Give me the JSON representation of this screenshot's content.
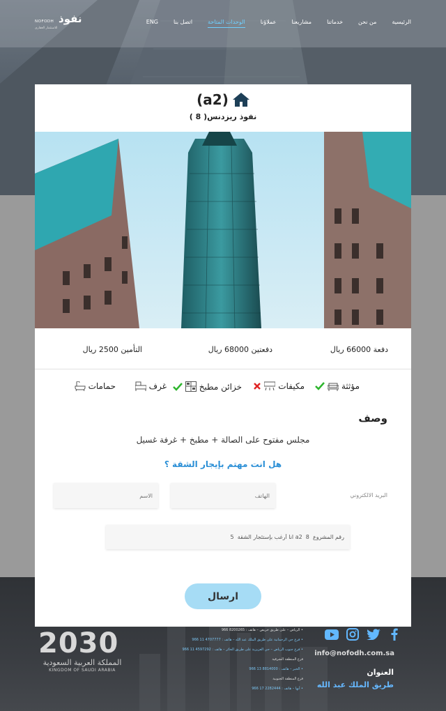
{
  "nav": {
    "logo_ar": "نفوذ",
    "logo_en": "NOFODH",
    "logo_sub": "للاستثمار العقاري",
    "links": [
      "الرئيسية",
      "من نحن",
      "خدماتنا",
      "مشاريعنا",
      "عملاؤنا",
      "الوحدات المتاحة",
      "اتصل بنا",
      "ENG"
    ],
    "active_index": 5
  },
  "unit": {
    "code": "(a2)",
    "project": "نفوذ ريزدنس( 8 )"
  },
  "prices": {
    "first": "دفعة 66000 ريال",
    "second": "دفعتين 68000 ريال",
    "insurance": "التأمين 2500 ريال"
  },
  "features": {
    "furnished": "مؤثثة",
    "ac": "مكيفات",
    "kitchen": "خزائن مطبخ",
    "rooms": "غرف",
    "bathrooms": "حمامات"
  },
  "description": {
    "heading": "وصف",
    "text": "مجلس مفتوح على الصالة + مطبخ + غرفة غسيل"
  },
  "form": {
    "heading": "هل انت مهتم بإيجار الشقة ؟",
    "email_label": "البريد الالكتروني",
    "phone_placeholder": "الهاتف",
    "name_placeholder": "الاسم",
    "message_value": "رقم المشروع  8  a2 انا أرغب بإستئجار الشقة  5",
    "submit_label": "ارسال"
  },
  "footer": {
    "vision_number": "2030",
    "vision_ar": "المملكة العربية السعودية",
    "vision_en": "KINGDOM OF SAUDI ARABIA",
    "branches": [
      {
        "text": "• الرياض – على طريق خريص – هاتف : ‎966 8200265",
        "blue": false
      },
      {
        "text": "• فرع حي الرحمانية على طريق الملك عبد الله – هاتف : ‎966 11 4707777",
        "blue": true
      },
      {
        "text": "• فرع جنوب الرياض – حي العزيزية على طريق الحائر – هاتف : ‎966 11 4597292",
        "blue": true
      },
      {
        "text": "فرع المنطقة الشرقية",
        "blue": false
      },
      {
        "text": "• الخبر – هاتف : ‎966 13 8814000",
        "blue": true
      },
      {
        "text": "فرع المنطقة الجنوبية",
        "blue": false
      },
      {
        "text": "• أبها – هاتف : ‎966 17 2282444",
        "blue": true
      }
    ],
    "email": "info@nofodh.com.sa",
    "address_heading": "العنوان",
    "address": "طريق الملك عبد الله"
  },
  "colors": {
    "accent": "#2b8fd6",
    "submit_bg": "#a6dcf5",
    "check": "#2db52d",
    "cross": "#e02424"
  }
}
